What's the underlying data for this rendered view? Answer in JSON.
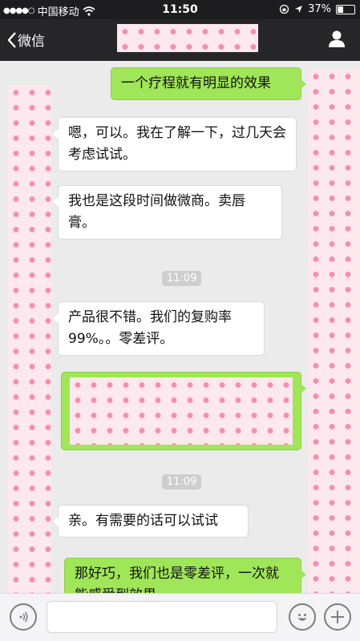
{
  "status_bar": {
    "signal_dots": "●●●●○",
    "carrier": "中国移动",
    "time": "11:50",
    "battery": "37%",
    "battery_level": 0.37
  },
  "nav": {
    "back_label": "微信",
    "back_icon": "chevron-left-icon",
    "profile_icon": "person-icon"
  },
  "messages": [
    {
      "side": "out",
      "text": "一个疗程就有明显的效果"
    },
    {
      "side": "in",
      "text": "嗯，可以。我在了解一下，过几天会考虑试试。"
    },
    {
      "side": "in",
      "text": "我也是这段时间做微商。卖唇膏。"
    },
    {
      "type": "time",
      "text": "11:09"
    },
    {
      "side": "in",
      "text": "产品很不错。我们的复购率99%。。零差评。"
    },
    {
      "side": "out",
      "type": "redacted"
    },
    {
      "type": "time",
      "text": "11:09"
    },
    {
      "side": "in",
      "text": "亲。有需要的话可以试试"
    },
    {
      "side": "out",
      "text": "那好巧，我们也是零差评，一次就能感受到效果"
    }
  ],
  "input_bar": {
    "voice_icon": "voice-icon",
    "emoji_icon": "emoji-icon",
    "plus_icon": "plus-icon"
  },
  "colors": {
    "nav_bg": "#262628",
    "outgoing_bubble": "#9fe658",
    "incoming_bubble": "#ffffff",
    "chat_bg": "#ebebeb",
    "redaction_pink": "#fde8ee"
  }
}
